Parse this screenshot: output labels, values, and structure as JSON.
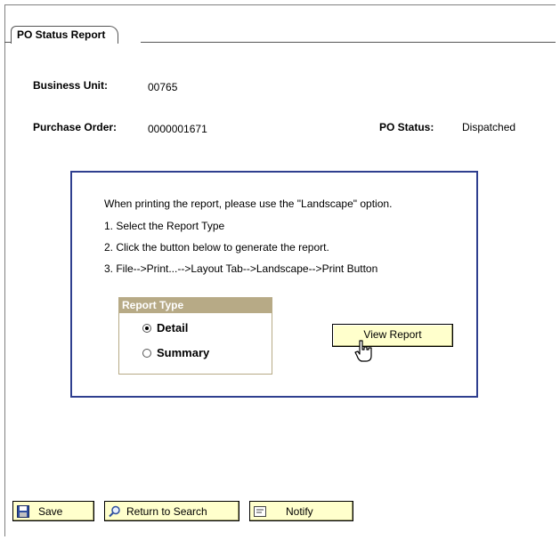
{
  "page": {
    "tab_label": "PO Status Report"
  },
  "header_fields": {
    "business_unit_label": "Business Unit:",
    "business_unit_value": "00765",
    "purchase_order_label": "Purchase Order:",
    "purchase_order_value": "0000001671",
    "po_status_label": "PO Status:",
    "po_status_value": "Dispatched"
  },
  "instructions": {
    "line1": "When printing the report, please use the \"Landscape\" option.",
    "line2": "1. Select the Report Type",
    "line3": "2. Click the button below to generate the report.",
    "line4": "3. File-->Print...-->Layout Tab-->Landscape-->Print Button"
  },
  "report_type": {
    "title": "Report Type",
    "options": [
      {
        "label": "Detail",
        "selected": true
      },
      {
        "label": "Summary",
        "selected": false
      }
    ]
  },
  "view_report_label": "View Report",
  "toolbar": {
    "save_label": "Save",
    "return_label": "Return to Search",
    "notify_label": "Notify"
  },
  "icons": [
    "save-icon",
    "search-icon",
    "notify-icon",
    "hand-cursor-icon"
  ],
  "colors": {
    "button_bg": "#ffffcc",
    "group_header": "#b7aa86",
    "box_border": "#2f3f8f"
  }
}
